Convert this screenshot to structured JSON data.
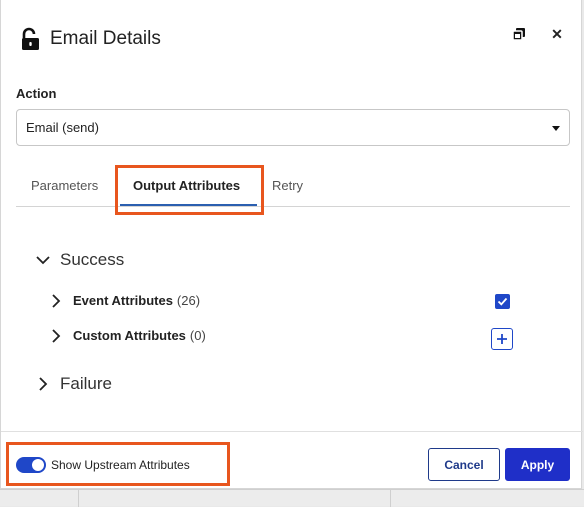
{
  "dialog": {
    "title": "Email Details",
    "icons": {
      "lock": "unlock-icon",
      "restore": "restore-window-icon",
      "close": "close-icon"
    },
    "close_glyph": "✕"
  },
  "action": {
    "label": "Action",
    "selected": "Email (send)"
  },
  "tabs": [
    {
      "label": "Parameters",
      "active": false
    },
    {
      "label": "Output Attributes",
      "active": true
    },
    {
      "label": "Retry",
      "active": false
    }
  ],
  "tree": {
    "success": {
      "label": "Success",
      "expanded": true,
      "items": [
        {
          "name": "Event Attributes",
          "count": "(26)",
          "checked": true
        },
        {
          "name": "Custom Attributes",
          "count": "(0)",
          "action": "+"
        }
      ]
    },
    "failure": {
      "label": "Failure",
      "expanded": false
    }
  },
  "footer": {
    "toggle_label": "Show Upstream Attributes",
    "toggle_on": true,
    "cancel_label": "Cancel",
    "apply_label": "Apply"
  },
  "colors": {
    "accent": "#1f47c8",
    "highlight": "#e8561e",
    "tab_underline": "#2b5fb0"
  }
}
